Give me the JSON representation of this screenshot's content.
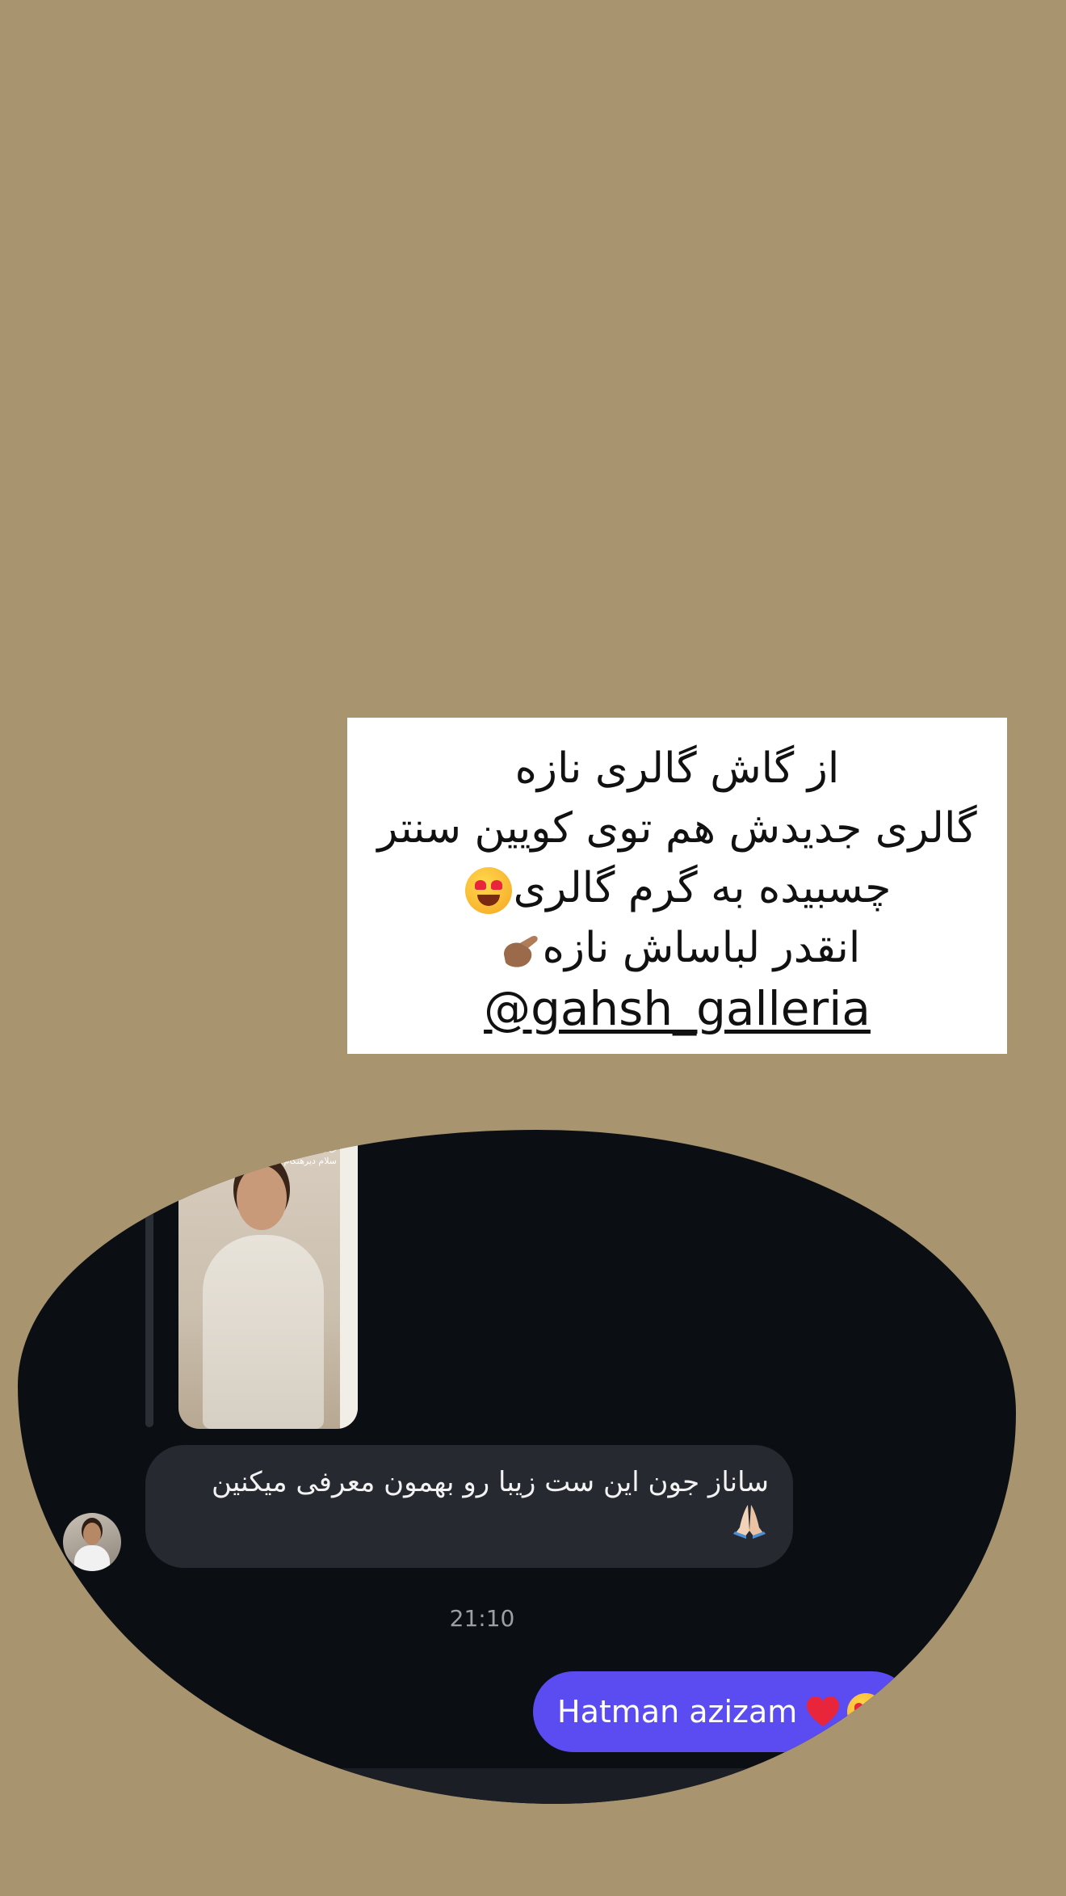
{
  "caption": {
    "line1": "از گاش گالری نازه",
    "line2": "گالری جدیدش هم توی کویین سنتر",
    "line3": "چسبیده به گرم گالری",
    "line4": "انقدر لباساش نازه",
    "handle": "@gahsh_galleria",
    "emoji_line3": "heart-eyes-emoji",
    "emoji_line4": "pinched-fingers-emoji"
  },
  "chat": {
    "story_overlay_text": "حالا سلام\nسلام دیرهنگام ❤️",
    "incoming_message": "ساناز جون این ست زیبا رو بهمون معرفی میکنین",
    "incoming_emoji": "folded-hands-emoji",
    "timestamp": "21:10",
    "outgoing_message": "Hatman azizam",
    "outgoing_emojis": [
      "red-heart-emoji",
      "heart-eyes-emoji"
    ]
  },
  "colors": {
    "background": "#a8946f",
    "chat_background": "#0b0f14",
    "incoming_bubble": "#262a30",
    "outgoing_bubble": "#5a4cf0",
    "caption_box": "#ffffff"
  }
}
